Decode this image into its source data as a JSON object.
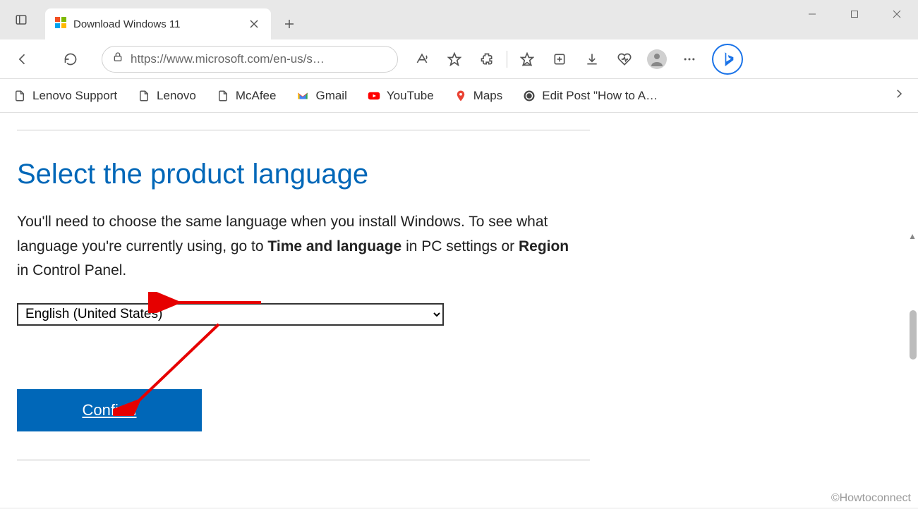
{
  "window": {
    "controls": {
      "minimize": "—",
      "maximize": "☐",
      "close": "✕"
    }
  },
  "tab": {
    "title": "Download Windows 11"
  },
  "address": {
    "url": "https://www.microsoft.com/en-us/s…"
  },
  "favorites": {
    "items": [
      {
        "label": "Lenovo Support",
        "icon": "page"
      },
      {
        "label": "Lenovo",
        "icon": "page"
      },
      {
        "label": "McAfee",
        "icon": "page"
      },
      {
        "label": "Gmail",
        "icon": "gmail"
      },
      {
        "label": "YouTube",
        "icon": "youtube"
      },
      {
        "label": "Maps",
        "icon": "maps"
      },
      {
        "label": "Edit Post \"How to A…",
        "icon": "wp"
      }
    ]
  },
  "page": {
    "heading": "Select the product language",
    "desc_part1": "You'll need to choose the same language when you install Windows. To see what language you're currently using, go to ",
    "desc_bold1": "Time and language",
    "desc_part2": " in PC settings or ",
    "desc_bold2": "Region",
    "desc_part3": " in Control Panel.",
    "language_selected": "English (United States)",
    "confirm_label": "Confirm"
  },
  "watermark": "©Howtoconnect"
}
